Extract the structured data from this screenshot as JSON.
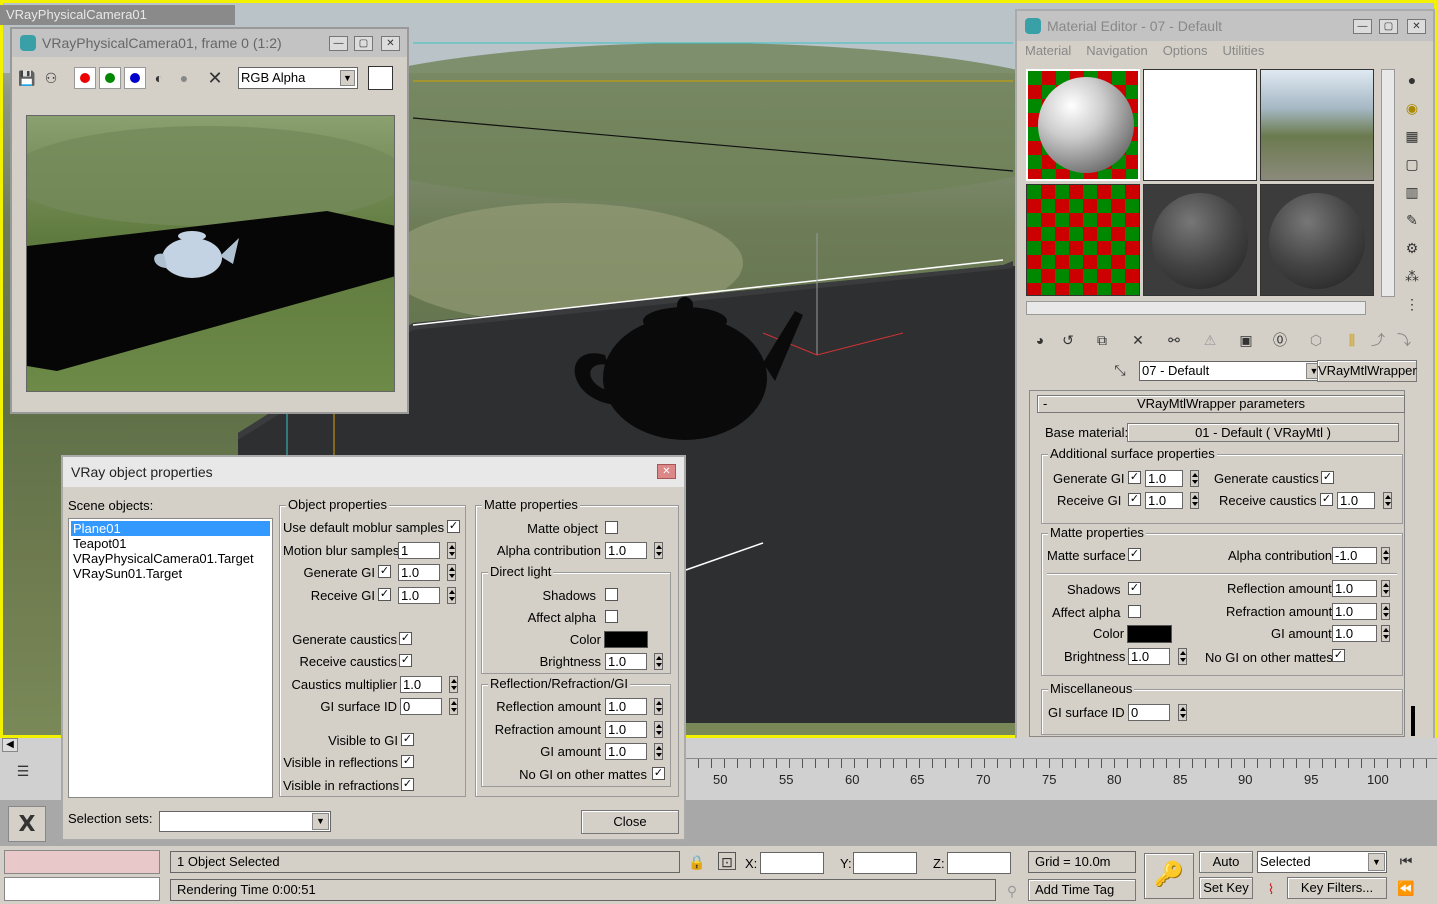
{
  "bg_tab": "VRayPhysicalCamera01",
  "fb": {
    "title": "VRayPhysicalCamera01, frame 0 (1:2)",
    "channel": "RGB Alpha"
  },
  "me": {
    "title": "Material Editor - 07 - Default",
    "menu": [
      "Material",
      "Navigation",
      "Options",
      "Utilities"
    ],
    "mat_name": "07 - Default",
    "mat_type": "VRayMtlWrapper",
    "rollout": "VRayMtlWrapper parameters",
    "rollout_toggle": "-",
    "base_label": "Base material:",
    "base_value": "01 - Default  ( VRayMtl )",
    "add_group": "Additional surface properties",
    "gen_gi": "Generate GI",
    "gen_gi_val": "1.0",
    "rec_gi": "Receive GI",
    "rec_gi_val": "1.0",
    "gen_caus": "Generate caustics",
    "rec_caus": "Receive caustics",
    "rec_caus_val": "1.0",
    "matte_group": "Matte properties",
    "matte_surface": "Matte surface",
    "alpha_contrib": "Alpha contribution",
    "alpha_contrib_val": "-1.0",
    "shadows": "Shadows",
    "affect_alpha": "Affect alpha",
    "color": "Color",
    "brightness": "Brightness",
    "brightness_val": "1.0",
    "refl_amt": "Reflection amount",
    "refl_val": "1.0",
    "refr_amt": "Refraction amount",
    "refr_val": "1.0",
    "gi_amt": "GI amount",
    "gi_val": "1.0",
    "no_gi": "No GI on other mattes",
    "misc_group": "Miscellaneous",
    "gi_surface": "GI surface ID",
    "gi_surface_val": "0"
  },
  "vop": {
    "title": "VRay object properties",
    "scene_label": "Scene objects:",
    "objects": [
      "Plane01",
      "Teapot01",
      "VRayPhysicalCamera01.Target",
      "VRaySun01.Target"
    ],
    "obj_group": "Object properties",
    "use_moblur": "Use default moblur samples",
    "moblur_samples": "Motion blur samples",
    "moblur_val": "1",
    "gen_gi": "Generate GI",
    "gen_gi_val": "1.0",
    "rec_gi": "Receive GI",
    "rec_gi_val": "1.0",
    "gen_caus": "Generate caustics",
    "rec_caus": "Receive caustics",
    "caus_mult": "Caustics multiplier",
    "caus_mult_val": "1.0",
    "gi_surface": "GI surface ID",
    "gi_surface_val": "0",
    "vis_gi": "Visible to GI",
    "vis_refl": "Visible in reflections",
    "vis_refr": "Visible in refractions",
    "matte_group": "Matte properties",
    "matte_obj": "Matte object",
    "alpha_contrib": "Alpha contribution",
    "alpha_val": "1.0",
    "direct_group": "Direct light",
    "shadows": "Shadows",
    "affect_alpha": "Affect alpha",
    "color": "Color",
    "brightness": "Brightness",
    "brightness_val": "1.0",
    "rrg_group": "Reflection/Refraction/GI",
    "refl_amt": "Reflection amount",
    "refl_val": "1.0",
    "refr_amt": "Refraction amount",
    "refr_val": "1.0",
    "gi_amt": "GI amount",
    "gi_val": "1.0",
    "no_gi": "No GI on other mattes",
    "sel_sets": "Selection sets:",
    "close": "Close"
  },
  "timeline": {
    "labels": [
      "50",
      "55",
      "60",
      "65",
      "70",
      "75",
      "80",
      "85",
      "90",
      "95",
      "100"
    ]
  },
  "status": {
    "selected": "1 Object Selected",
    "render_time": "Rendering Time  0:00:51",
    "x": "X:",
    "y": "Y:",
    "z": "Z:",
    "grid": "Grid = 10.0m",
    "add_time_tag": "Add Time Tag",
    "auto_key": "Auto Key",
    "set_key": "Set Key",
    "key_mode": "Selected",
    "key_filters": "Key Filters..."
  },
  "colors": {
    "viewport_border": "#ffff00",
    "titlebar_inactive": "#c3c3c3",
    "titlebar_active": "#e8e8e8",
    "selection": "#3399ff"
  }
}
